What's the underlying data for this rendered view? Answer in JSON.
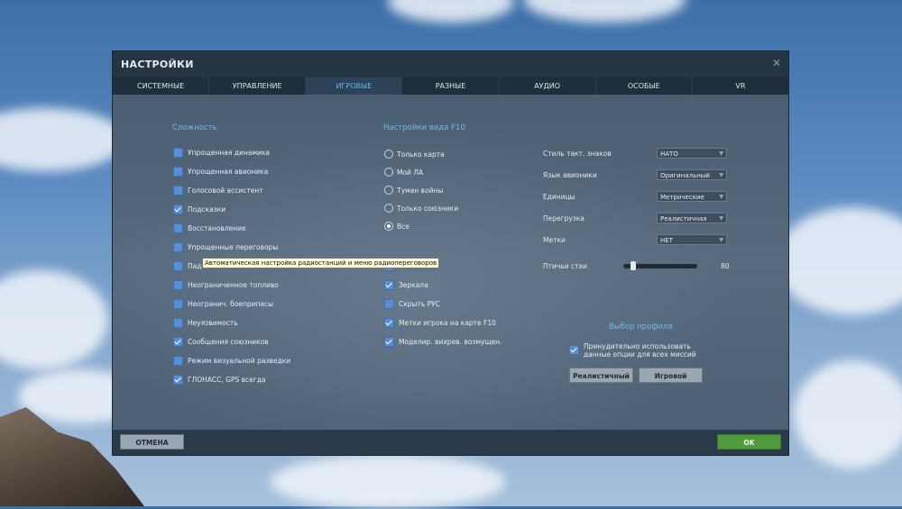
{
  "window": {
    "title": "НАСТРОЙКИ"
  },
  "tabs": [
    {
      "label": "СИСТЕМНЫЕ"
    },
    {
      "label": "УПРАВЛЕНИЕ"
    },
    {
      "label": "ИГРОВЫЕ",
      "active": true
    },
    {
      "label": "РАЗНЫЕ"
    },
    {
      "label": "АУДИО"
    },
    {
      "label": "ОСОБЫЕ"
    },
    {
      "label": "VR"
    }
  ],
  "difficulty": {
    "title": "Сложность",
    "items": [
      {
        "label": "Упрощенная динамика",
        "checked": false
      },
      {
        "label": "Упрощенная авионика",
        "checked": false
      },
      {
        "label": "Голосовой ассистент",
        "checked": false
      },
      {
        "label": "Подсказки",
        "checked": true
      },
      {
        "label": "Восстановление",
        "checked": false
      },
      {
        "label": "Упрощенные переговоры",
        "checked": false
      },
      {
        "label": "Падл",
        "checked": false
      },
      {
        "label": "Неограниченное топливо",
        "checked": false
      },
      {
        "label": "Неогранич. боеприпасы",
        "checked": false
      },
      {
        "label": "Неуязвимость",
        "checked": false
      },
      {
        "label": "Сообщения союзников",
        "checked": true
      },
      {
        "label": "Режим визуальной разведки",
        "checked": false
      },
      {
        "label": "ГЛОНАСС, GPS всегда",
        "checked": true
      }
    ]
  },
  "f10": {
    "title": "Настройки вида F10",
    "radios": [
      {
        "label": "Только карта",
        "selected": false
      },
      {
        "label": "Мой ЛА",
        "selected": false
      },
      {
        "label": "Туман войны",
        "selected": false
      },
      {
        "label": "Только союзники",
        "selected": false
      },
      {
        "label": "Все",
        "selected": true
      }
    ],
    "checks": [
      {
        "label": "ки ИЛС",
        "checked": false
      },
      {
        "label": "Зеркала",
        "checked": true
      },
      {
        "label": "Скрыть РУС",
        "checked": false
      },
      {
        "label": "Метки игрока на карте F10",
        "checked": true
      },
      {
        "label": "Моделир. вихрев. возмущен.",
        "checked": true
      }
    ]
  },
  "options": [
    {
      "label": "Стиль такт. знаков",
      "value": "НАТО"
    },
    {
      "label": "Язык авионики",
      "value": "Оригинальный"
    },
    {
      "label": "Единицы",
      "value": "Метрические"
    },
    {
      "label": "Перегрузка",
      "value": "Реалистичная"
    },
    {
      "label": "Метки",
      "value": "НЕТ"
    }
  ],
  "flock": {
    "label": "Птичьи стаи",
    "value": "80",
    "max": 100
  },
  "profile": {
    "title": "Выбор профиля",
    "force_line1": "Принудительно использовать",
    "force_line2": "данные опции для всех миссий",
    "force_checked": true,
    "btn_realistic": "Реалистичный",
    "btn_game": "Игровой"
  },
  "tooltip": "Автоматическая настройка радиостанций и меню радиопереговоров",
  "footer": {
    "cancel": "ОТМЕНА",
    "ok": "OK"
  },
  "colors": {
    "accent": "#6fb9ea",
    "checkbox": "#5b8ed0",
    "ok": "#4f9a3c"
  }
}
